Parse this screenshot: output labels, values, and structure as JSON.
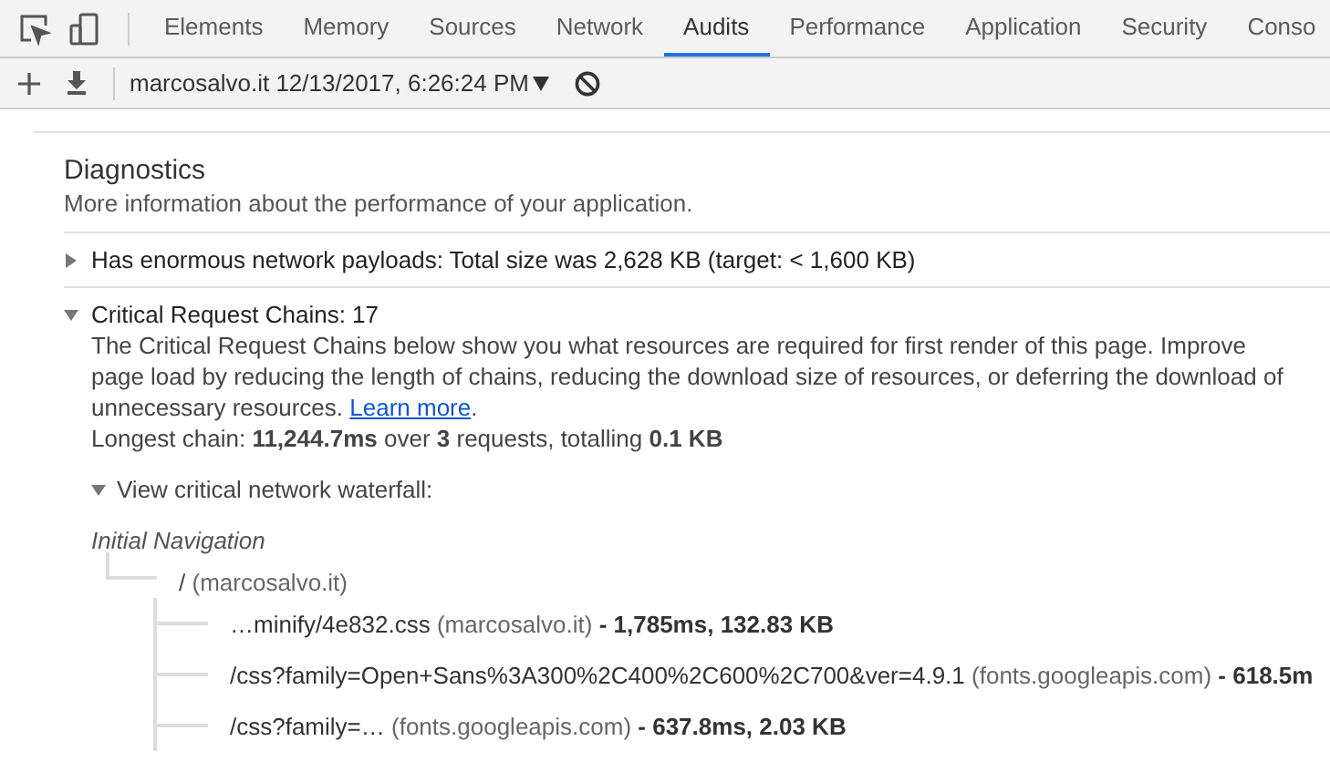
{
  "tabs": [
    {
      "label": "Elements",
      "selected": false
    },
    {
      "label": "Memory",
      "selected": false
    },
    {
      "label": "Sources",
      "selected": false
    },
    {
      "label": "Network",
      "selected": false
    },
    {
      "label": "Audits",
      "selected": true
    },
    {
      "label": "Performance",
      "selected": false
    },
    {
      "label": "Application",
      "selected": false
    },
    {
      "label": "Security",
      "selected": false
    },
    {
      "label": "Conso",
      "selected": false
    }
  ],
  "toolbar": {
    "report": "marcosalvo.it 12/13/2017, 6:26:24 PM"
  },
  "section": {
    "title": "Diagnostics",
    "description": "More information about the performance of your application."
  },
  "audits": [
    {
      "title": "Has enormous network payloads: Total size was 2,628 KB (target: < 1,600 KB)",
      "expanded": false
    },
    {
      "title": "Critical Request Chains: 17",
      "expanded": true,
      "description": "The Critical Request Chains below show you what resources are required for first render of this page. Improve page load by reducing the length of chains, reducing the download size of resources, or deferring the download of unnecessary resources.",
      "link": "Learn more",
      "after_link": ".",
      "summary": "Longest chain: **11,244.7ms** over **3** requests, totalling **0.1 KB**",
      "waterfall": {
        "label": "View critical network waterfall:",
        "expanded": true,
        "root": "Initial Navigation",
        "children": [
          {
            "path": "/",
            "host": "(marcosalvo.it)",
            "children": [
              {
                "path": "…minify/4e832.css",
                "host": "(marcosalvo.it)",
                "timing": "- 1,785ms, 132.83 KB"
              },
              {
                "path": "/css?family=Open+Sans%3A300%2C400%2C600%2C700&ver=4.9.1",
                "host": "(fonts.googleapis.com)",
                "timing": "- 618.5m"
              },
              {
                "path": "/css?family=…",
                "host": "(fonts.googleapis.com)",
                "timing": "- 637.8ms, 2.03 KB"
              }
            ]
          }
        ]
      }
    }
  ]
}
